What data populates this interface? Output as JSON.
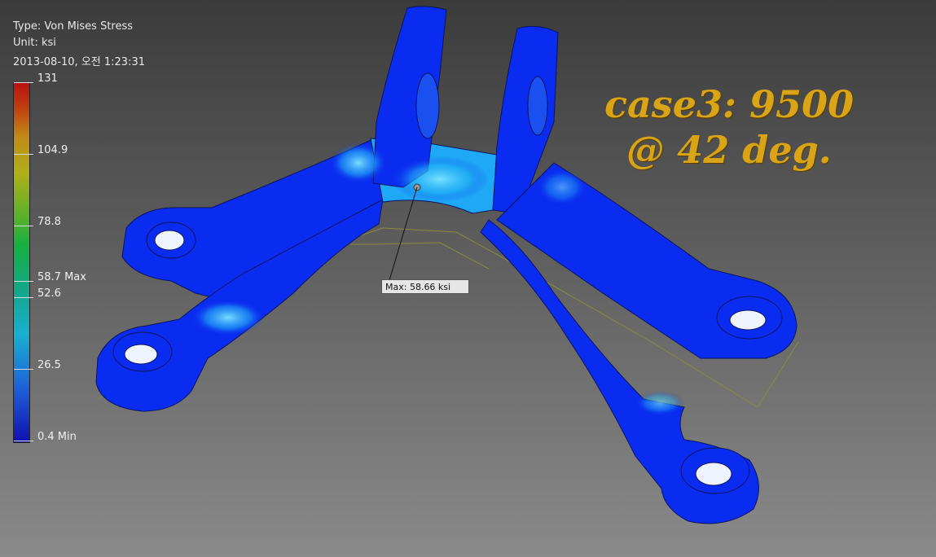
{
  "header": {
    "type_line": "Type: Von Mises Stress",
    "unit_line": "Unit: ksi",
    "date_line": "2013-08-10, 오전 1:23:31"
  },
  "legend": {
    "ticks": [
      {
        "label": "131"
      },
      {
        "label": "104.9"
      },
      {
        "label": "78.8"
      },
      {
        "label": "58.7 Max"
      },
      {
        "label": "52.6"
      },
      {
        "label": "26.5"
      },
      {
        "label": "0.4 Min"
      }
    ]
  },
  "case_title": {
    "line1": "case3: 9500",
    "line2": "@ 42 deg."
  },
  "probe": {
    "label": "Max: 58.66 ksi"
  },
  "colors": {
    "part_blue": "#0a2cf0",
    "stress_cyan": "#1ec8f0",
    "title_gold": "#d9a416"
  }
}
